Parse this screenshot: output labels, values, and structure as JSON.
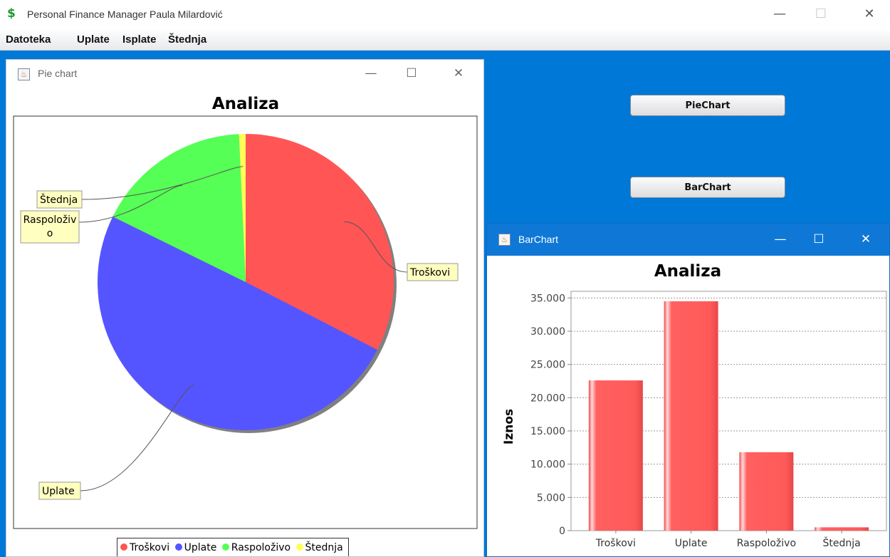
{
  "app": {
    "title": "Personal Finance Manager Paula Milardović",
    "icon": "dollar-icon",
    "window_buttons": {
      "minimize": "—",
      "maximize": "☐",
      "close": "✕"
    }
  },
  "menu": [
    {
      "label": "Datoteka"
    },
    {
      "label": "Uplate"
    },
    {
      "label": "Isplate"
    },
    {
      "label": "Štednja"
    }
  ],
  "desktop": {
    "color": "#0078d7",
    "buttons": {
      "pie": "PieChart",
      "bar": "BarChart"
    }
  },
  "pie_window": {
    "title": "Pie chart",
    "chart_title": "Analiza"
  },
  "bar_window": {
    "title": "BarChart",
    "chart_title": "Analiza"
  },
  "chart_data": [
    {
      "type": "pie",
      "title": "Analiza",
      "categories": [
        "Troškovi",
        "Uplate",
        "Raspoloživo",
        "Štednja"
      ],
      "values": [
        22600,
        34500,
        11800,
        500
      ],
      "colors": [
        "#ff5555",
        "#5555ff",
        "#55ff55",
        "#ffff55"
      ],
      "labels": {
        "Troškovi": "Troškovi",
        "Uplate": "Uplate",
        "Raspoloživo": "Raspoloživ o",
        "Štednja": "Štednja"
      },
      "legend": [
        "Troškovi",
        "Uplate",
        "Raspoloživo",
        "Štednja"
      ],
      "legend_placement": "bottom"
    },
    {
      "type": "bar",
      "title": "Analiza",
      "categories": [
        "Troškovi",
        "Uplate",
        "Raspoloživo",
        "Štednja"
      ],
      "values": [
        22600,
        34500,
        11800,
        500
      ],
      "ylabel": "Iznos",
      "xlabel": "",
      "ylim": [
        0,
        36000
      ],
      "yticks": [
        0,
        5000,
        10000,
        15000,
        20000,
        25000,
        30000,
        35000
      ],
      "ytick_labels": [
        "0",
        "5.000",
        "10.000",
        "15.000",
        "20.000",
        "25.000",
        "30.000",
        "35.000"
      ],
      "grid": true,
      "color": "#ff5555"
    }
  ]
}
